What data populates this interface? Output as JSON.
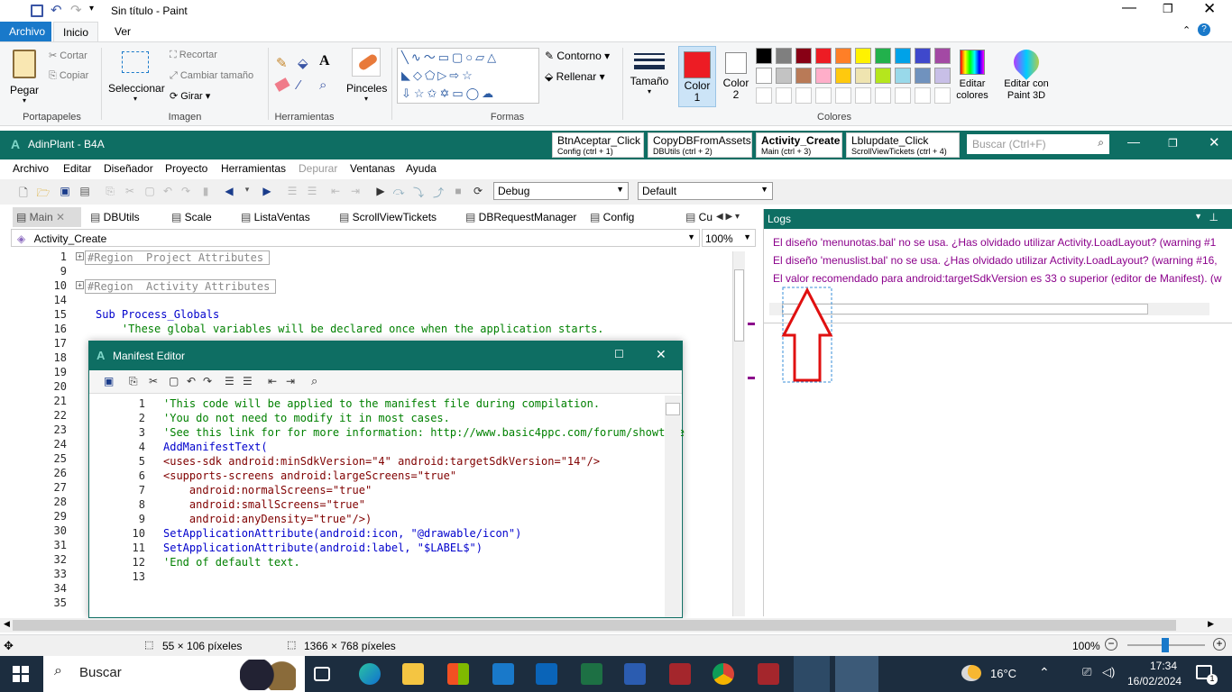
{
  "paint": {
    "title": "Sin título - Paint",
    "tabs": [
      "Archivo",
      "Inicio",
      "Ver"
    ],
    "clipboard": {
      "paste": "Pegar",
      "cut": "Cortar",
      "copy": "Copiar",
      "group": "Portapapeles"
    },
    "image": {
      "select": "Seleccionar",
      "crop": "Recortar",
      "resize": "Cambiar tamaño",
      "rotate": "Girar",
      "group": "Imagen"
    },
    "tools": {
      "group": "Herramientas",
      "brushes": "Pinceles"
    },
    "shapes": {
      "outline": "Contorno",
      "fill": "Rellenar",
      "group": "Formas"
    },
    "size": "Tamaño",
    "color1": "Color 1",
    "color2": "Color 2",
    "edit_colors": "Editar colores",
    "paint3d": "Editar con Paint 3D",
    "colors_group": "Colores",
    "palette": [
      "#000000",
      "#7f7f7f",
      "#880015",
      "#ed1c24",
      "#ff7f27",
      "#fff200",
      "#22b14c",
      "#00a2e8",
      "#3f48cc",
      "#a349a4",
      "#ffffff",
      "#c3c3c3",
      "#b97a57",
      "#ffaec9",
      "#ffc90e",
      "#efe4b0",
      "#b5e61d",
      "#99d9ea",
      "#7092be",
      "#c8bfe7"
    ],
    "status": {
      "selection": "55 × 106 píxeles",
      "canvas": "1366 × 768 píxeles",
      "zoom": "100%"
    }
  },
  "b4a": {
    "title": "AdinPlant - B4A",
    "quick_tabs": [
      {
        "title": "BtnAceptar_Click",
        "sub": "Config  (ctrl + 1)"
      },
      {
        "title": "CopyDBFromAssets",
        "sub": "DBUtils  (ctrl + 2)"
      },
      {
        "title": "Activity_Create",
        "sub": "Main  (ctrl + 3)"
      },
      {
        "title": "Lblupdate_Click",
        "sub": "ScrollViewTickets  (ctrl + 4)"
      }
    ],
    "search_placeholder": "Buscar (Ctrl+F)",
    "menu": [
      "Archivo",
      "Editar",
      "Diseñador",
      "Proyecto",
      "Herramientas",
      "Depurar",
      "Ventanas",
      "Ayuda"
    ],
    "build_mode": "Debug",
    "build_config": "Default",
    "file_tabs": [
      "Main",
      "DBUtils",
      "Scale",
      "ListaVentas",
      "ScrollViewTickets",
      "DBRequestManager",
      "Config",
      "Cu"
    ],
    "sub_select": "Activity_Create",
    "zoom": "100%",
    "logs_title": "Logs",
    "logs": [
      "El diseño 'menunotas.bal' no se usa. ¿Has olvidado utilizar Activity.LoadLayout? (warning #1",
      "El diseño 'menuslist.bal' no se usa. ¿Has olvidado utilizar Activity.LoadLayout? (warning #16,",
      "El valor recomendado para android:targetSdkVersion es 33 o superior (editor de Manifest). (w"
    ],
    "code_lines": [
      {
        "n": "1",
        "t": "#Region  Project Attributes"
      },
      {
        "n": "9",
        "t": ""
      },
      {
        "n": "10",
        "t": "#Region  Activity Attributes"
      },
      {
        "n": "14",
        "t": ""
      },
      {
        "n": "15",
        "t": "Sub Process_Globals"
      },
      {
        "n": "16",
        "t": "    'These global variables will be declared once when the application starts."
      },
      {
        "n": "17",
        "t": ""
      },
      {
        "n": "18",
        "t": ""
      },
      {
        "n": "19",
        "t": ""
      },
      {
        "n": "20",
        "t": ""
      },
      {
        "n": "21",
        "t": ""
      },
      {
        "n": "22",
        "t": ""
      },
      {
        "n": "23",
        "t": ""
      },
      {
        "n": "24",
        "t": ""
      },
      {
        "n": "25",
        "t": ""
      },
      {
        "n": "26",
        "t": ""
      },
      {
        "n": "27",
        "t": ""
      },
      {
        "n": "28",
        "t": ""
      },
      {
        "n": "29",
        "t": ""
      },
      {
        "n": "30",
        "t": ""
      },
      {
        "n": "31",
        "t": ""
      },
      {
        "n": "32",
        "t": ""
      },
      {
        "n": "33",
        "t": ""
      },
      {
        "n": "34",
        "t": ""
      },
      {
        "n": "35",
        "t": ""
      }
    ]
  },
  "manifest": {
    "title": "Manifest Editor",
    "lines": [
      {
        "n": "1",
        "t": "'This code will be applied to the manifest file during compilation."
      },
      {
        "n": "2",
        "t": "'You do not need to modify it in most cases."
      },
      {
        "n": "3",
        "t": "'See this link for for more information: http://www.basic4ppc.com/forum/showthre"
      },
      {
        "n": "4",
        "t": "AddManifestText("
      },
      {
        "n": "5",
        "t": "<uses-sdk android:minSdkVersion=\"4\" android:targetSdkVersion=\"14\"/>"
      },
      {
        "n": "6",
        "t": "<supports-screens android:largeScreens=\"true\""
      },
      {
        "n": "7",
        "t": "    android:normalScreens=\"true\""
      },
      {
        "n": "8",
        "t": "    android:smallScreens=\"true\""
      },
      {
        "n": "9",
        "t": "    android:anyDensity=\"true\"/>)"
      },
      {
        "n": "10",
        "t": "SetApplicationAttribute(android:icon, \"@drawable/icon\")"
      },
      {
        "n": "11",
        "t": "SetApplicationAttribute(android:label, \"$LABEL$\")"
      },
      {
        "n": "12",
        "t": "'End of default text."
      },
      {
        "n": "13",
        "t": ""
      }
    ]
  },
  "taskbar": {
    "search": "Buscar",
    "weather": "16°C",
    "time": "17:34",
    "date": "16/02/2024",
    "notifications": "1"
  }
}
